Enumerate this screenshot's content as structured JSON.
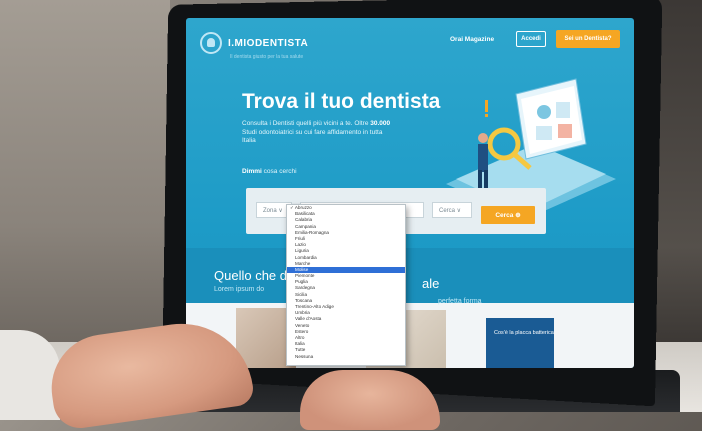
{
  "header": {
    "logo_text": "I.MIODENTISTA",
    "logo_tag": "Il dentista giusto per la tua salute",
    "nav_link": "Orai Magazine",
    "login": "Accedi",
    "cta": "Sei un Dentista?"
  },
  "hero": {
    "title": "Trova il tuo dentista",
    "desc_pre": "Consulta i Dentisti quelli più vicini a te. Oltre ",
    "desc_bold": "30.000",
    "desc_post": " Studi odontoiatrici su cui fare affidamento in tutta Italia",
    "hint_bold": "Dimmi",
    "hint_rest": " cosa cerchi"
  },
  "search": {
    "field1": "Zona ∨",
    "field3": "Cerca ∨",
    "button": "Cerca ⊕"
  },
  "dropdown": {
    "items": [
      "Abruzzo",
      "Basilicata",
      "Calabria",
      "Campania",
      "Emilia-Romagna",
      "Friuli",
      "Lazio",
      "Liguria",
      "Lombardia",
      "Marche",
      "Molise",
      "Piemonte",
      "Puglia",
      "Sardegna",
      "Sicilia",
      "Toscana",
      "Trentino-Alto Adige",
      "Umbria",
      "Valle d'Aosta",
      "Veneto",
      "Estero",
      "Altro",
      "Italia",
      "Tutte",
      "Nessuna"
    ],
    "checked_index": 0,
    "selected_index": 10
  },
  "band": {
    "title_left": "Quello che d",
    "title_right": "ale",
    "sub_left": "Lorem ipsum do",
    "sub_right": "perfetta forma"
  },
  "card": {
    "text": "Cos'è la placca batterica"
  }
}
